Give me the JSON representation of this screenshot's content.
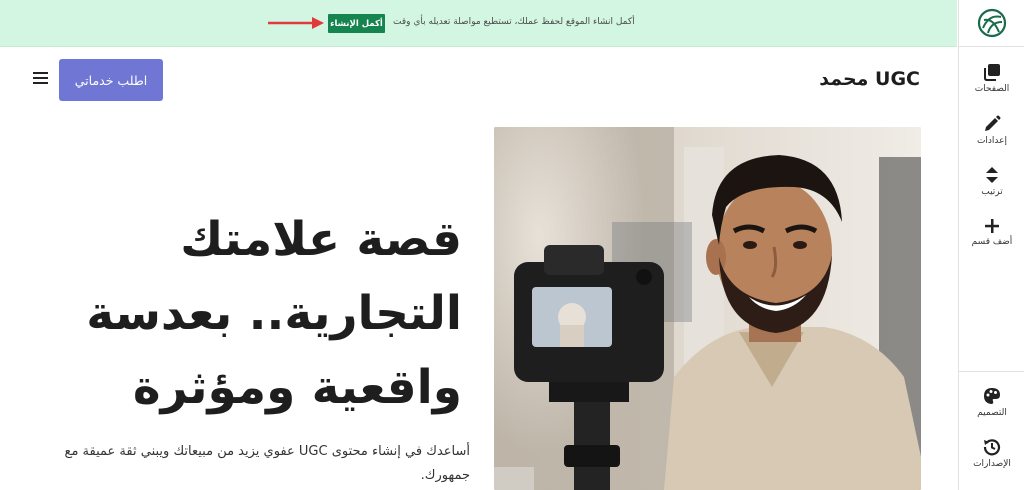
{
  "notice": {
    "text": "أكمل انشاء الموقع لحفظ عملك، تستطيع مواصلة تعديله بأي وقت",
    "button_label": "أكمل الإنشاء"
  },
  "header": {
    "site_title": "محمد UGC",
    "cta_label": "اطلب خدماتي"
  },
  "hero": {
    "title": "قصة علامتك التجارية.. بعدسة واقعية ومؤثرة",
    "description": "أساعدك في إنشاء محتوى UGC عفوي يزيد من مبيعاتك ويبني ثقة عميقة مع جمهورك."
  },
  "sidebar": {
    "items": [
      {
        "label": "الصفحات",
        "icon": "pages-icon"
      },
      {
        "label": "إعدادات",
        "icon": "pencil-icon"
      },
      {
        "label": "ترتيب",
        "icon": "sort-icon"
      },
      {
        "label": "أضف قسم",
        "icon": "plus-icon"
      },
      {
        "label": "التصميم",
        "icon": "palette-icon"
      },
      {
        "label": "الإصدارات",
        "icon": "history-icon"
      }
    ]
  },
  "colors": {
    "notice_bg": "#d3f6e3",
    "notice_button": "#16844f",
    "cta": "#6f76d3",
    "arrow": "#e03a3a"
  }
}
